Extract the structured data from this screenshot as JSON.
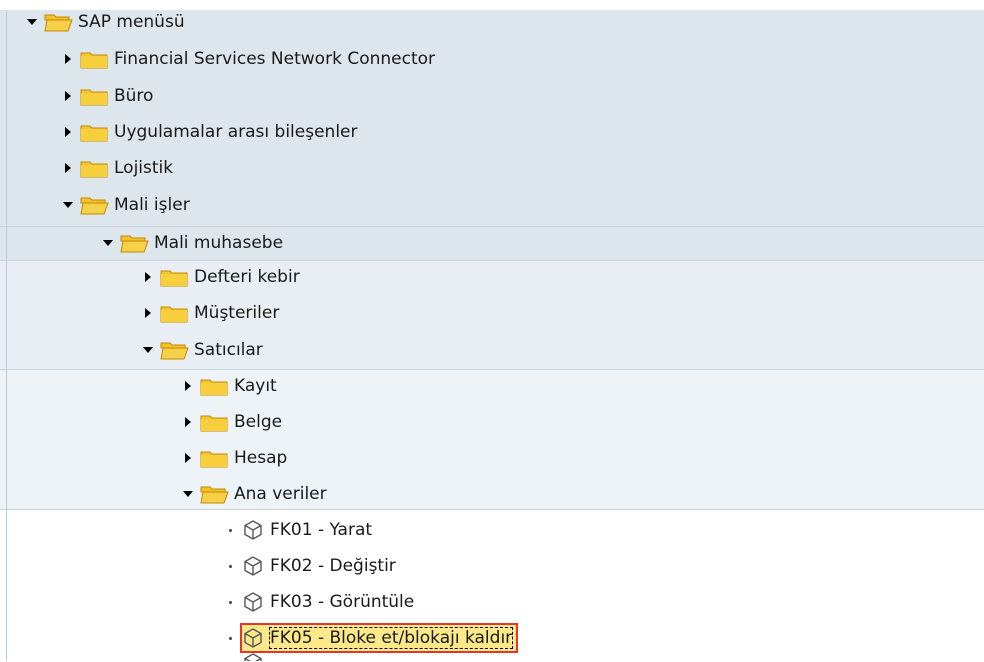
{
  "menu": {
    "root": "SAP menüsü",
    "items": [
      "Financial Services Network Connector",
      "Büro",
      "Uygulamalar arası bileşenler",
      "Lojistik",
      "Mali işler",
      "Mali muhasebe",
      "Defteri kebir",
      "Müşteriler",
      "Satıcılar",
      "Kayıt",
      "Belge",
      "Hesap",
      "Ana veriler",
      "FK01 - Yarat",
      "FK02 - Değiştir",
      "FK03 - Görüntüle",
      "FK05 - Bloke et/blokajı kaldır"
    ]
  },
  "colors": {
    "folder": "#f4c430",
    "selection_border": "#e8352b",
    "selection_fill": "#fde88a",
    "band": "#dde5ed"
  },
  "icons": {
    "expanded": "triangle-down",
    "collapsed": "triangle-right",
    "folder_closed": "folder-closed-icon",
    "folder_open": "folder-open-icon",
    "transaction": "cube-icon"
  }
}
